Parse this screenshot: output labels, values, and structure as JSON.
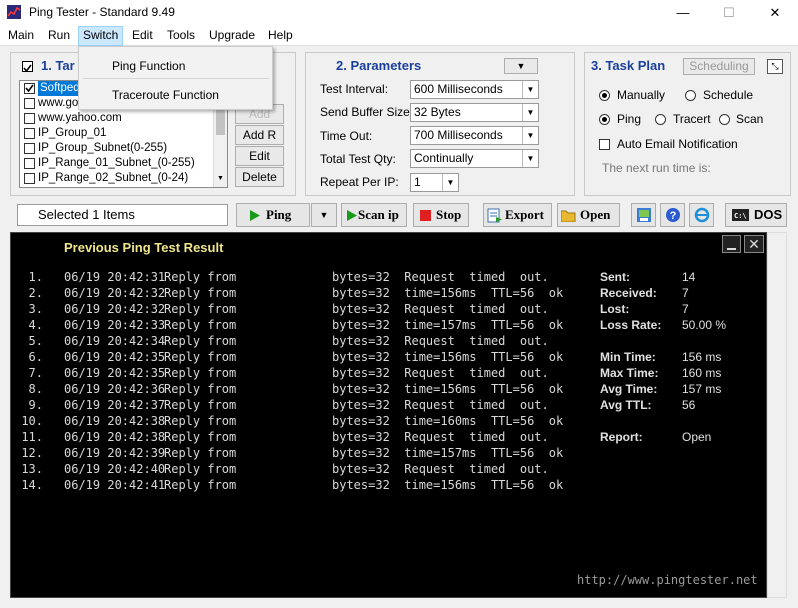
{
  "window": {
    "title": "Ping Tester - Standard  9.49",
    "minimize": "—",
    "maximize": "☐",
    "close": "✕"
  },
  "menu": [
    "Main",
    "Run",
    "Switch",
    "Edit",
    "Tools",
    "Upgrade",
    "Help"
  ],
  "dropdown": {
    "items": [
      "Ping Function",
      "Traceroute Function"
    ]
  },
  "targets": {
    "title": "1. Tar",
    "items": [
      {
        "label": "Softpedia",
        "checked": true
      },
      {
        "label": "www.google.com",
        "checked": false
      },
      {
        "label": "www.yahoo.com",
        "checked": false
      },
      {
        "label": "IP_Group_01",
        "checked": false
      },
      {
        "label": "IP_Group_Subnet(0-255)",
        "checked": false
      },
      {
        "label": "IP_Range_01_Subnet_(0-255)",
        "checked": false
      },
      {
        "label": "IP_Range_02_Subnet_(0-24)",
        "checked": false
      }
    ],
    "buttons": [
      "Add",
      "Add R",
      "Edit",
      "Delete"
    ]
  },
  "parameters": {
    "title": "2. Parameters",
    "rows": [
      {
        "label": "Test Interval:",
        "value": "600  Milliseconds"
      },
      {
        "label": "Send Buffer Size:",
        "value": "32  Bytes"
      },
      {
        "label": "Time Out:",
        "value": "700  Milliseconds"
      },
      {
        "label": "Total Test Qty:",
        "value": "Continually"
      },
      {
        "label": "Repeat Per IP:",
        "value": "1"
      }
    ]
  },
  "task_plan": {
    "title": "3. Task Plan",
    "scheduling_button": "Scheduling",
    "manually": "Manually",
    "schedule": "Schedule",
    "ping": "Ping",
    "tracert": "Tracert",
    "scan": "Scan",
    "email": "Email Notification",
    "auto": "Auto",
    "next_run": "The next run time is:"
  },
  "toolbar": {
    "selected": "Selected 1 Items",
    "ping": "Ping",
    "scan_ip": "Scan ip",
    "stop": "Stop",
    "export": "Export",
    "open": "Open",
    "dos": "DOS"
  },
  "console": {
    "heading": "Previous Ping Test Result",
    "rows": [
      {
        "n": "1.",
        "time": "06/19 20:42:31",
        "reply": "Reply from",
        "result": "bytes=32  Request  timed  out."
      },
      {
        "n": "2.",
        "time": "06/19 20:42:32",
        "reply": "Reply from",
        "result": "bytes=32  time=156ms  TTL=56  ok"
      },
      {
        "n": "3.",
        "time": "06/19 20:42:32",
        "reply": "Reply from",
        "result": "bytes=32  Request  timed  out."
      },
      {
        "n": "4.",
        "time": "06/19 20:42:33",
        "reply": "Reply from",
        "result": "bytes=32  time=157ms  TTL=56  ok"
      },
      {
        "n": "5.",
        "time": "06/19 20:42:34",
        "reply": "Reply from",
        "result": "bytes=32  Request  timed  out."
      },
      {
        "n": "6.",
        "time": "06/19 20:42:35",
        "reply": "Reply from",
        "result": "bytes=32  time=156ms  TTL=56  ok"
      },
      {
        "n": "7.",
        "time": "06/19 20:42:35",
        "reply": "Reply from",
        "result": "bytes=32  Request  timed  out."
      },
      {
        "n": "8.",
        "time": "06/19 20:42:36",
        "reply": "Reply from",
        "result": "bytes=32  time=156ms  TTL=56  ok"
      },
      {
        "n": "9.",
        "time": "06/19 20:42:37",
        "reply": "Reply from",
        "result": "bytes=32  Request  timed  out."
      },
      {
        "n": "10.",
        "time": "06/19 20:42:38",
        "reply": "Reply from",
        "result": "bytes=32  time=160ms  TTL=56  ok"
      },
      {
        "n": "11.",
        "time": "06/19 20:42:38",
        "reply": "Reply from",
        "result": "bytes=32  Request  timed  out."
      },
      {
        "n": "12.",
        "time": "06/19 20:42:39",
        "reply": "Reply from",
        "result": "bytes=32  time=157ms  TTL=56  ok"
      },
      {
        "n": "13.",
        "time": "06/19 20:42:40",
        "reply": "Reply from",
        "result": "bytes=32  Request  timed  out."
      },
      {
        "n": "14.",
        "time": "06/19 20:42:41",
        "reply": "Reply from",
        "result": "bytes=32  time=156ms  TTL=56  ok"
      }
    ],
    "stats": [
      {
        "label": "Sent:",
        "value": "14"
      },
      {
        "label": "Received:",
        "value": "7"
      },
      {
        "label": "Lost:",
        "value": "7"
      },
      {
        "label": "Loss Rate:",
        "value": "50.00 %"
      },
      {
        "label": "Min Time:",
        "value": "156 ms"
      },
      {
        "label": "Max Time:",
        "value": "160 ms"
      },
      {
        "label": "Avg Time:",
        "value": "157 ms"
      },
      {
        "label": "Avg TTL:",
        "value": "56"
      },
      {
        "label": "Report:",
        "value": "Open"
      }
    ],
    "footer_url": "http://www.pingtester.net"
  },
  "colors": {
    "heading": "#f0e68c",
    "section_title": "#1a3f9c",
    "console_bg": "#000000"
  }
}
